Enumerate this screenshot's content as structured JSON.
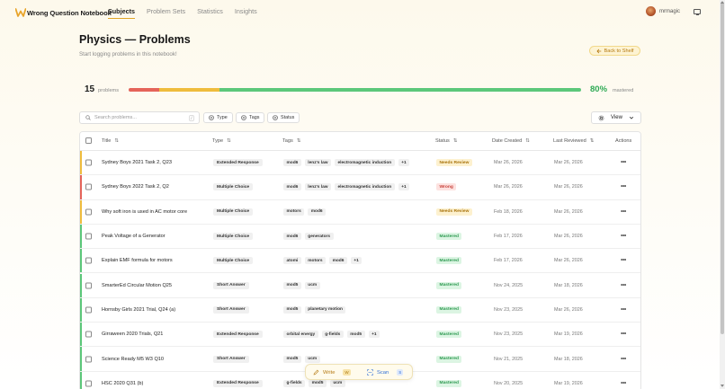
{
  "app": {
    "name": "Wrong Question Notebook",
    "nav": [
      "Subjects",
      "Problem Sets",
      "Statistics",
      "Insights"
    ],
    "active_nav": "Subjects",
    "username": "mrmagic"
  },
  "page": {
    "title": "Physics — Problems",
    "subtitle": "Start logging problems in this notebook!",
    "back_label": "Back to Shelf"
  },
  "summary": {
    "count": "15",
    "count_label": "problems",
    "mastered_pct": "80%",
    "mastered_label": "mastered",
    "fractions": {
      "wrong": 0.067,
      "needs_review": 0.133,
      "mastered": 0.8
    },
    "colors": {
      "wrong": "#e5645a",
      "needs_review": "#efbc3d",
      "mastered": "#5cc77a"
    }
  },
  "toolbar": {
    "search_placeholder": "Search problems...",
    "search_shortcut": "/",
    "filters": [
      "Type",
      "Tags",
      "Status"
    ],
    "view_label": "View"
  },
  "table": {
    "headers": {
      "title": "Title",
      "type": "Type",
      "tags": "Tags",
      "status": "Status",
      "created": "Date Created",
      "reviewed": "Last Reviewed",
      "actions": "Actions"
    },
    "rows": [
      {
        "title": "Sydney Boys 2021 Task 2, Q23",
        "type": "Extended Response",
        "tags": [
          "mod6",
          "lenz's law",
          "electromagnetic induction",
          "+1"
        ],
        "status": "Needs Review",
        "created": "Mar 26, 2026",
        "reviewed": "Mar 26, 2026"
      },
      {
        "title": "Sydney Boys 2022 Task 2, Q2",
        "type": "Multiple Choice",
        "tags": [
          "mod6",
          "lenz's law",
          "electromagnetic induction",
          "+1"
        ],
        "status": "Wrong",
        "created": "Mar 26, 2026",
        "reviewed": "Mar 26, 2026"
      },
      {
        "title": "Why soft iron is used in AC motor core",
        "type": "Multiple Choice",
        "tags": [
          "motors",
          "mod6"
        ],
        "status": "Needs Review",
        "created": "Feb 18, 2026",
        "reviewed": "Mar 26, 2026"
      },
      {
        "title": "Peak Voltage of a Generator",
        "type": "Multiple Choice",
        "tags": [
          "mod6",
          "generators"
        ],
        "status": "Mastered",
        "created": "Feb 17, 2026",
        "reviewed": "Mar 26, 2026"
      },
      {
        "title": "Explain EMF formula for motors",
        "type": "Multiple Choice",
        "tags": [
          "atomi",
          "motors",
          "mod6",
          "+1"
        ],
        "status": "Mastered",
        "created": "Feb 17, 2026",
        "reviewed": "Mar 26, 2026"
      },
      {
        "title": "SmarterEd Circular Motion Q25",
        "type": "Short Answer",
        "tags": [
          "mod5",
          "ucm"
        ],
        "status": "Mastered",
        "created": "Nov 24, 2025",
        "reviewed": "Mar 18, 2026"
      },
      {
        "title": "Hornsby Girls 2021 Trial, Q24 (a)",
        "type": "Short Answer",
        "tags": [
          "mod5",
          "planetary motion"
        ],
        "status": "Mastered",
        "created": "Nov 23, 2025",
        "reviewed": "Mar 26, 2026"
      },
      {
        "title": "Girraween 2020 Trials, Q21",
        "type": "Extended Response",
        "tags": [
          "orbital energy",
          "g-fields",
          "mod5",
          "+1"
        ],
        "status": "Mastered",
        "created": "Nov 23, 2025",
        "reviewed": "Mar 19, 2026"
      },
      {
        "title": "Science Ready M5 W3 Q10",
        "type": "Short Answer",
        "tags": [
          "mod5",
          "ucm"
        ],
        "status": "Mastered",
        "created": "Nov 21, 2025",
        "reviewed": "Mar 18, 2026"
      },
      {
        "title": "HSC 2020 Q31 (b)",
        "type": "Extended Response",
        "tags": [
          "g-fields",
          "mod5",
          "ucm"
        ],
        "status": "Mastered",
        "created": "Nov 20, 2025",
        "reviewed": "Mar 19, 2026"
      }
    ]
  },
  "status_styles": {
    "Needs Review": {
      "bg": "#fdf1cf",
      "fg": "#a8730c",
      "accent": "#efbc3d"
    },
    "Wrong": {
      "bg": "#fde2e0",
      "fg": "#c8413a",
      "accent": "#e5645a"
    },
    "Mastered": {
      "bg": "#dcf5e3",
      "fg": "#2f9a52",
      "accent": "#5cc77a"
    }
  },
  "floating": {
    "write_label": "Write",
    "write_key": "W",
    "scan_label": "Scan",
    "scan_key": "S"
  }
}
